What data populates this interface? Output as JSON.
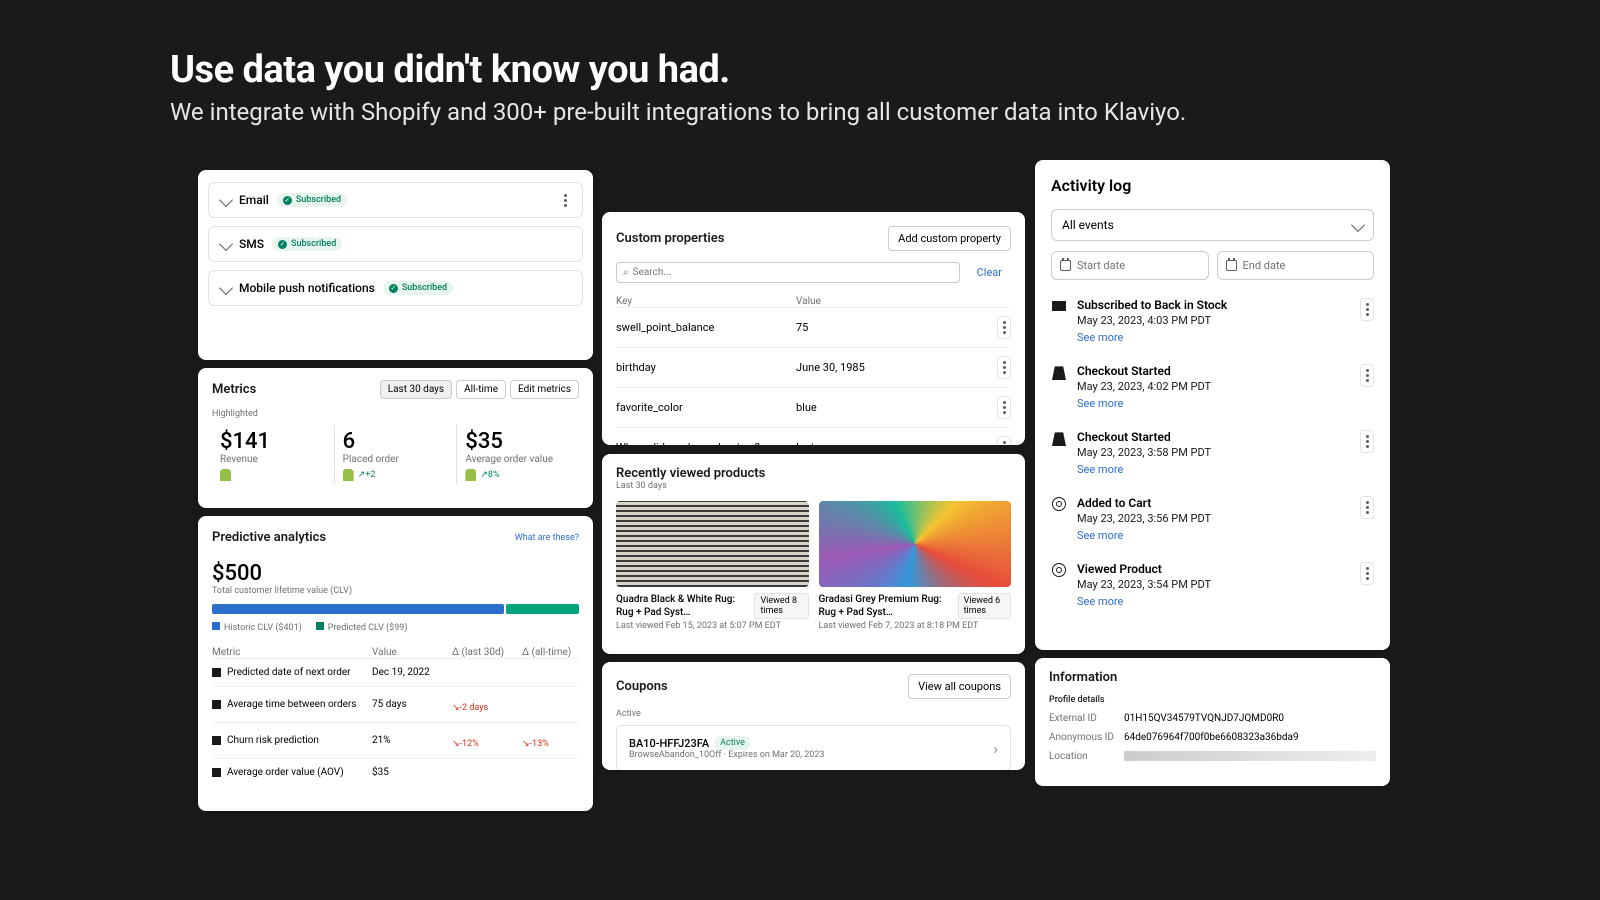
{
  "hero": {
    "title": "Use data you didn't know you had.",
    "subtitle": "We integrate with Shopify and 300+ pre-built integrations to bring all customer data into Klaviyo."
  },
  "channels": [
    {
      "name": "Email",
      "status": "Subscribed"
    },
    {
      "name": "SMS",
      "status": "Subscribed"
    },
    {
      "name": "Mobile push notifications",
      "status": "Subscribed"
    }
  ],
  "metrics": {
    "title": "Metrics",
    "range_buttons": [
      "Last 30 days",
      "All-time",
      "Edit metrics"
    ],
    "section": "Highlighted",
    "stats": [
      {
        "value": "$141",
        "label": "Revenue",
        "delta": ""
      },
      {
        "value": "6",
        "label": "Placed order",
        "delta": "+2"
      },
      {
        "value": "$35",
        "label": "Average order value",
        "delta": "8%"
      }
    ]
  },
  "predictive": {
    "title": "Predictive analytics",
    "help": "What are these?",
    "clv_value": "$500",
    "clv_label": "Total customer lifetime value (CLV)",
    "legend": [
      {
        "label": "Historic CLV ($401)",
        "color": "#2c6ecb"
      },
      {
        "label": "Predicted CLV ($99)",
        "color": "#008060"
      }
    ],
    "cols": [
      "Metric",
      "Value",
      "Δ (last 30d)",
      "Δ (all-time)"
    ],
    "rows": [
      {
        "metric": "Predicted date of next order",
        "value": "Dec 19, 2022",
        "d30": "",
        "dall": ""
      },
      {
        "metric": "Average time between orders",
        "value": "75 days",
        "d30": "-2 days",
        "dall": ""
      },
      {
        "metric": "Churn risk prediction",
        "value": "21%",
        "d30": "-12%",
        "dall": "-13%"
      },
      {
        "metric": "Average order value (AOV)",
        "value": "$35",
        "d30": "",
        "dall": ""
      }
    ]
  },
  "custom_props": {
    "title": "Custom properties",
    "add_btn": "Add custom property",
    "search_ph": "Search...",
    "clear": "Clear",
    "cols": [
      "Key",
      "Value"
    ],
    "rows": [
      {
        "key": "swell_point_balance",
        "value": "75"
      },
      {
        "key": "birthday",
        "value": "June 30, 1985"
      },
      {
        "key": "favorite_color",
        "value": "blue"
      },
      {
        "key": "Where did you hear about us?",
        "value": "Instagram"
      }
    ]
  },
  "recent": {
    "title": "Recently viewed products",
    "range": "Last 30 days",
    "items": [
      {
        "title": "Quadra Black & White Rug: Rug + Pad Syst…",
        "views": "Viewed 8 times",
        "last": "Last viewed Feb 15, 2023 at 5:07 PM EDT"
      },
      {
        "title": "Gradasi Grey Premium Rug: Rug + Pad Syst…",
        "views": "Viewed 6 times",
        "last": "Last viewed Feb 7, 2023 at 8:18 PM EDT"
      }
    ]
  },
  "coupons": {
    "title": "Coupons",
    "view_all": "View all coupons",
    "section": "Active",
    "items": [
      {
        "code": "BA10-HFFJ23FA",
        "status": "Active",
        "desc": "BrowseAbandon_10Off · Expires on Mar 20, 2023"
      }
    ]
  },
  "activity": {
    "title": "Activity log",
    "filter": "All events",
    "start_ph": "Start date",
    "end_ph": "End date",
    "see_more": "See more",
    "events": [
      {
        "icon": "tag",
        "title": "Subscribed to Back in Stock",
        "time": "May 23, 2023, 4:03 PM PDT"
      },
      {
        "icon": "shop",
        "title": "Checkout Started",
        "time": "May 23, 2023, 4:02 PM PDT"
      },
      {
        "icon": "shop",
        "title": "Checkout Started",
        "time": "May 23, 2023, 3:58 PM PDT"
      },
      {
        "icon": "gear",
        "title": "Added to Cart",
        "time": "May 23, 2023, 3:56 PM PDT"
      },
      {
        "icon": "gear",
        "title": "Viewed Product",
        "time": "May 23, 2023, 3:54 PM PDT"
      }
    ]
  },
  "info": {
    "title": "Information",
    "section": "Profile details",
    "rows": [
      {
        "k": "External ID",
        "v": "01H15QV34579TVQNJD7JQMD0R0"
      },
      {
        "k": "Anonymous ID",
        "v": "64de076964f700f0be6608323a36bda9"
      },
      {
        "k": "Location",
        "v": ""
      }
    ]
  }
}
